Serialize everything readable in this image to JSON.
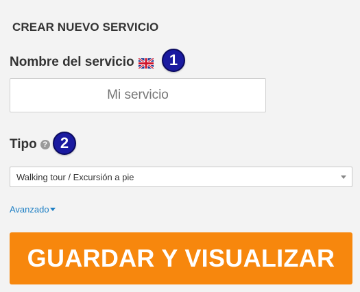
{
  "form": {
    "title": "CREAR NUEVO SERVICIO",
    "name_label": "Nombre del servicio",
    "name_flag_icon": "uk-flag-icon",
    "name_step": "1",
    "name_placeholder": "Mi servicio",
    "type_label": "Tipo",
    "type_help_icon": "question-circle-icon",
    "type_help_glyph": "?",
    "type_step": "2",
    "type_selected": "Walking tour / Excursión a pie",
    "advanced_label": "Avanzado",
    "save_label": "GUARDAR Y VISUALIZAR"
  },
  "colors": {
    "accent": "#f7870d",
    "badge": "#1a1aa0",
    "link": "#1e7fc4"
  }
}
